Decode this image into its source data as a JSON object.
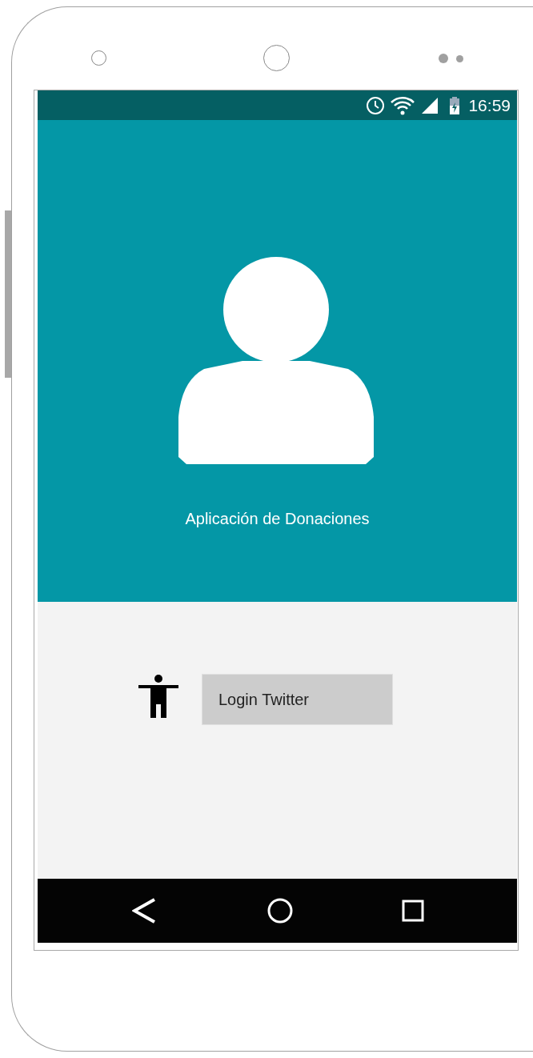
{
  "status_bar": {
    "time": "16:59"
  },
  "header": {
    "app_title": "Aplicación de Donaciones"
  },
  "login": {
    "button_label": "Login Twitter"
  }
}
